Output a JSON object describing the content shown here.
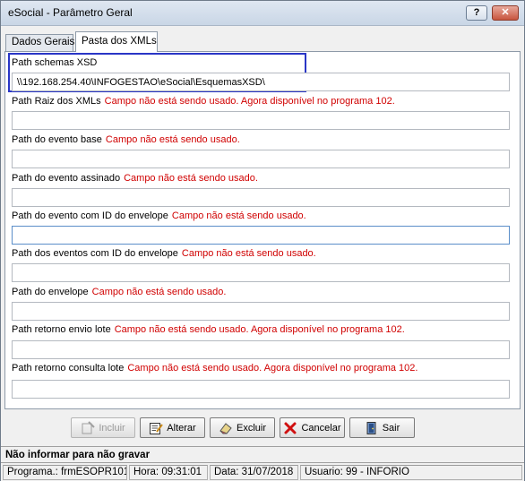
{
  "window": {
    "title": "eSocial - Parâmetro Geral",
    "help_label": "?",
    "close_label": "✕"
  },
  "tabs": [
    {
      "label": "Dados Gerais",
      "active": false
    },
    {
      "label": "Pasta dos XMLs",
      "active": true
    }
  ],
  "fields": [
    {
      "label": "Path schemas XSD",
      "warning": "",
      "value": "\\\\192.168.254.40\\INFOGESTAO\\eSocial\\EsquemasXSD\\"
    },
    {
      "label": "Path Raiz dos XMLs",
      "warning": "Campo não está sendo usado. Agora disponível no programa 102.",
      "value": ""
    },
    {
      "label": "Path do evento base",
      "warning": "Campo não está sendo usado.",
      "value": ""
    },
    {
      "label": "Path do evento assinado",
      "warning": "Campo não está sendo usado.",
      "value": ""
    },
    {
      "label": "Path do evento com ID do envelope",
      "warning": "Campo não está sendo usado.",
      "value": ""
    },
    {
      "label": "Path dos eventos com ID do envelope",
      "warning": "Campo não está sendo usado.",
      "value": ""
    },
    {
      "label": "Path do envelope",
      "warning": "Campo não está sendo usado.",
      "value": ""
    },
    {
      "label": "Path retorno envio lote",
      "warning": "Campo não está sendo usado. Agora disponível no programa 102.",
      "value": ""
    },
    {
      "label": "Path retorno consulta lote",
      "warning": "Campo não está sendo usado. Agora disponível no programa 102.",
      "value": ""
    }
  ],
  "buttons": {
    "incluir": {
      "label": "Incluir",
      "icon": "add-record-icon",
      "enabled": false
    },
    "alterar": {
      "label": "Alterar",
      "icon": "edit-document-icon",
      "enabled": true
    },
    "excluir": {
      "label": "Excluir",
      "icon": "eraser-icon",
      "enabled": true
    },
    "cancelar": {
      "label": "Cancelar",
      "icon": "red-x-icon",
      "enabled": true
    },
    "sair": {
      "label": "Sair",
      "icon": "exit-door-icon",
      "enabled": true
    }
  },
  "status_message": "Não informar para não gravar",
  "statusbar": {
    "programa": "Programa.: frmESOPR101",
    "hora": "Hora: 09:31:01",
    "data": "Data: 31/07/2018",
    "usuario": "Usuario: 99 - INFORIO"
  },
  "colors": {
    "warning": "#d00000",
    "highlight_border": "#2a36c6"
  }
}
